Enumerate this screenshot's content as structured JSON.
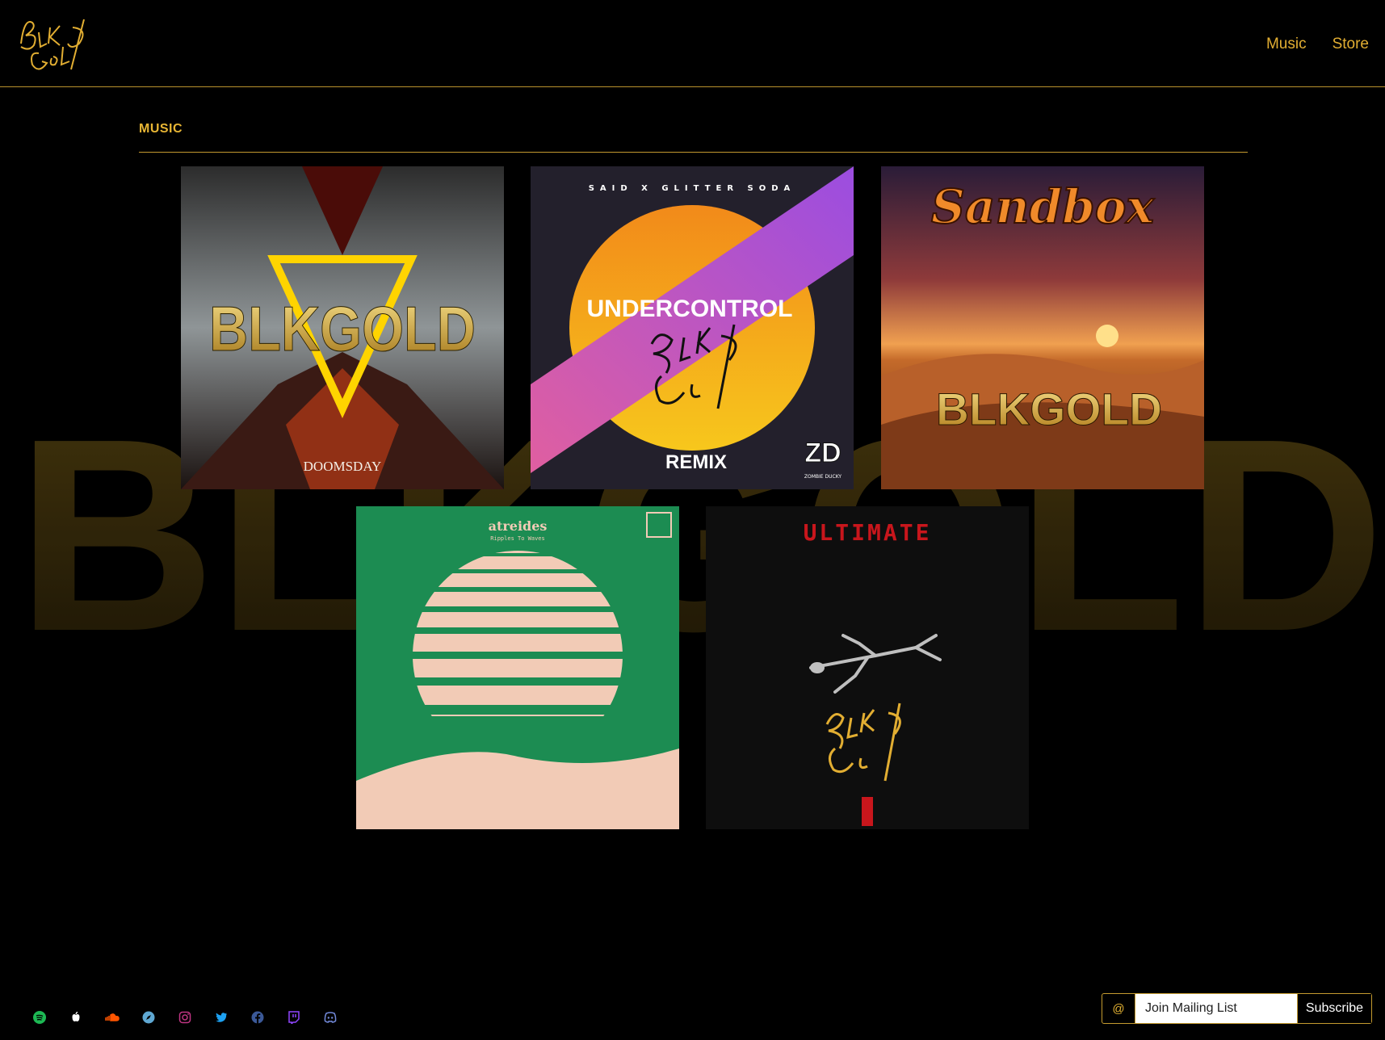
{
  "header": {
    "logo_text": "BLK GOLD",
    "nav": [
      {
        "label": "Music"
      },
      {
        "label": "Store"
      }
    ]
  },
  "watermark_text": "BLKGOLD",
  "section": {
    "title": "MUSIC"
  },
  "albums": [
    {
      "title": "DOOMSDAY",
      "artist_logo": "BLKGOLD"
    },
    {
      "top_credit": "SAID X GLITTER SODA",
      "title": "UNDERCONTROL",
      "subtitle": "REMIX",
      "label_logo": "ZD",
      "label_name": "ZOMBIE DUCKY"
    },
    {
      "title": "Sandbox",
      "artist_logo": "BLKGOLD"
    },
    {
      "artist": "atreides",
      "title": "Ripples To Waves"
    },
    {
      "title": "ULTIMATE"
    }
  ],
  "footer": {
    "social_icons": [
      "spotify-icon",
      "apple-music-icon",
      "soundcloud-icon",
      "compass-icon",
      "instagram-icon",
      "twitter-icon",
      "facebook-icon",
      "twitch-icon",
      "discord-icon"
    ],
    "mailing": {
      "at_symbol": "@",
      "placeholder": "Join Mailing List",
      "button_label": "Subscribe"
    }
  },
  "colors": {
    "gold": "#e7b534",
    "background": "#000000",
    "spotify": "#1db954",
    "soundcloud": "#ff5500",
    "twitter": "#1da1f2",
    "facebook": "#3b5998",
    "twitch": "#9146ff",
    "discord": "#7289da"
  }
}
